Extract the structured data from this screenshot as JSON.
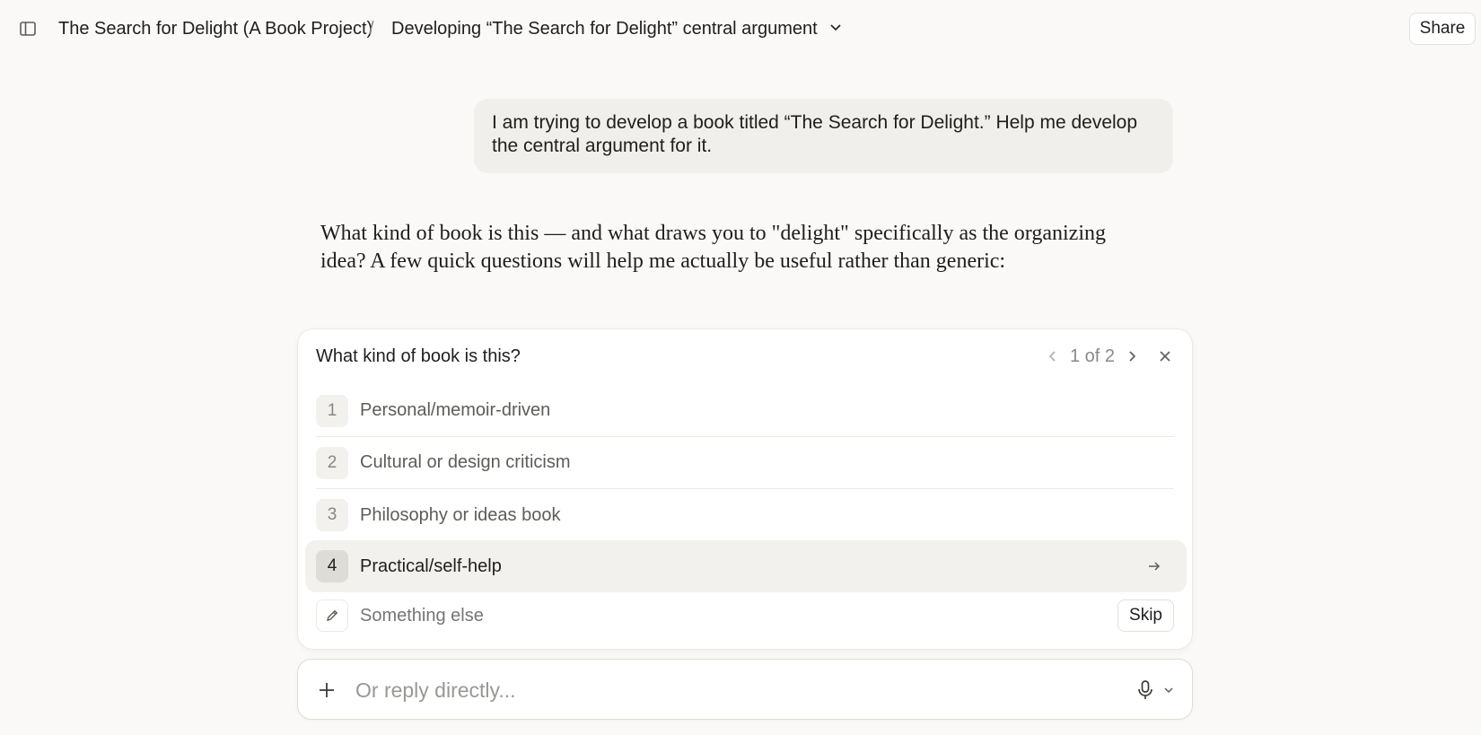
{
  "header": {
    "project": "The Search for Delight (A Book Project)",
    "separator": "/",
    "chat_title": "Developing “The Search for Delight” central argument",
    "share_label": "Share"
  },
  "conversation": {
    "user_message": "I am trying to develop a book titled “The Search for Delight.” Help me develop the central argument for it.",
    "assistant_message": "What kind of book is this — and what draws you to \"delight\" specifically as the organizing idea? A few quick questions will help me actually be useful rather than generic:"
  },
  "question_card": {
    "question": "What kind of book is this?",
    "pager": "1 of 2",
    "options": [
      {
        "num": "1",
        "label": "Personal/memoir-driven"
      },
      {
        "num": "2",
        "label": "Cultural or design criticism"
      },
      {
        "num": "3",
        "label": "Philosophy or ideas book"
      },
      {
        "num": "4",
        "label": "Practical/self-help"
      }
    ],
    "selected_index": 3,
    "other_placeholder": "Something else",
    "skip_label": "Skip"
  },
  "composer": {
    "placeholder": "Or reply directly..."
  },
  "icons": {
    "sidebar": "sidebar-toggle-icon",
    "chevron": "chevron-down-icon",
    "prev": "chevron-left-icon",
    "next": "chevron-right-icon",
    "close": "close-icon",
    "arrow": "arrow-right-icon",
    "pencil": "pencil-icon",
    "plus": "plus-icon",
    "mic": "microphone-icon"
  }
}
